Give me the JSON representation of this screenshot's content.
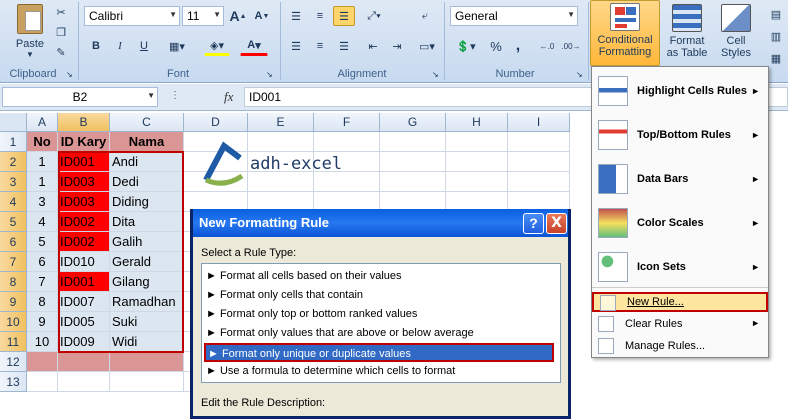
{
  "clipboard": {
    "paste_label": "Paste",
    "group_label": "Clipboard"
  },
  "font": {
    "name": "Calibri",
    "size": "11",
    "group_label": "Font",
    "bold": "B",
    "italic": "I",
    "underline": "U",
    "grow": "A",
    "shrink": "A",
    "color_a": "A"
  },
  "alignment": {
    "group_label": "Alignment"
  },
  "number": {
    "format": "General",
    "group_label": "Number",
    "percent": "%",
    "comma": ","
  },
  "styles": {
    "conditional_label_1": "Conditional",
    "conditional_label_2": "Formatting",
    "format_table_1": "Format",
    "format_table_2": "as Table",
    "cell_styles_1": "Cell",
    "cell_styles_2": "Styles"
  },
  "formula_bar": {
    "name_box": "B2",
    "fx": "fx",
    "value": "ID001"
  },
  "columns": [
    "A",
    "B",
    "C",
    "D",
    "E",
    "F",
    "G",
    "H",
    "I"
  ],
  "rows": [
    "1",
    "2",
    "3",
    "4",
    "5",
    "6",
    "7",
    "8",
    "9",
    "10",
    "11",
    "12",
    "13"
  ],
  "table": {
    "headers": [
      "No",
      "ID Kary",
      "Nama"
    ],
    "data": [
      [
        "1",
        "ID001",
        "Andi"
      ],
      [
        "1",
        "ID003",
        "Dedi"
      ],
      [
        "3",
        "ID003",
        "Diding"
      ],
      [
        "4",
        "ID002",
        "Dita"
      ],
      [
        "5",
        "ID002",
        "Galih"
      ],
      [
        "6",
        "ID010",
        "Gerald"
      ],
      [
        "7",
        "ID001",
        "Gilang"
      ],
      [
        "8",
        "ID007",
        "Ramadhan"
      ],
      [
        "9",
        "ID005",
        "Suki"
      ],
      [
        "10",
        "ID009",
        "Widi"
      ]
    ],
    "duplicate_flags": [
      true,
      true,
      true,
      true,
      true,
      false,
      true,
      false,
      false,
      false
    ],
    "duplicate_fill": "#ff0000",
    "header_fill": "#da9694",
    "body_fill": "#dce6f1"
  },
  "watermark": {
    "text": "adh-excel"
  },
  "dialog": {
    "title": "New Formatting Rule",
    "help": "?",
    "close": "X",
    "select_label": "Select a Rule Type:",
    "rules": [
      "► Format all cells based on their values",
      "► Format only cells that contain",
      "► Format only top or bottom ranked values",
      "► Format only values that are above or below average",
      "► Format only unique or duplicate values",
      "► Use a formula to determine which cells to format"
    ],
    "selected_index": 4,
    "edit_label": "Edit the Rule Description:"
  },
  "menu": {
    "items": [
      {
        "label": "Highlight Cells Rules",
        "icon": "highlight-cells-icon"
      },
      {
        "label": "Top/Bottom Rules",
        "icon": "top-bottom-icon"
      },
      {
        "label": "Data Bars",
        "icon": "data-bars-icon"
      },
      {
        "label": "Color Scales",
        "icon": "color-scales-icon"
      },
      {
        "label": "Icon Sets",
        "icon": "icon-sets-icon"
      }
    ],
    "new_rule": "New Rule...",
    "clear_rules": "Clear Rules",
    "manage_rules": "Manage Rules..."
  }
}
